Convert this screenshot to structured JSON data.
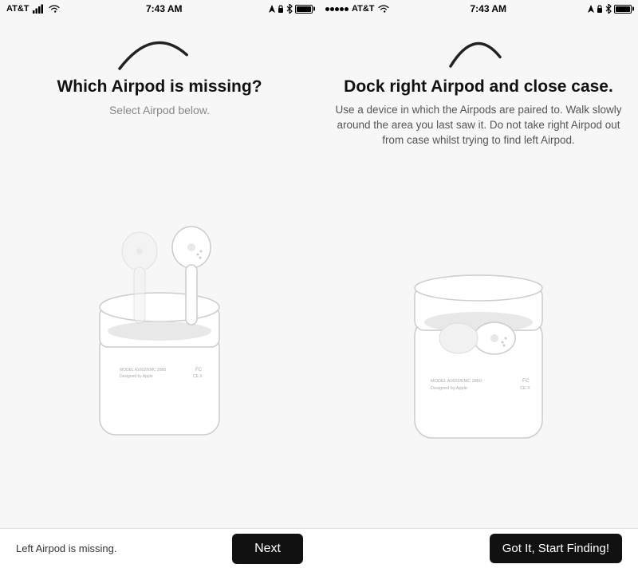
{
  "leftPanel": {
    "statusBar": {
      "carrier": "AT&T",
      "time": "7:43 AM",
      "battery": "100%"
    },
    "title": "Which Airpod is missing?",
    "subtitle": "Select Airpod below.",
    "bottomStatus": "Left Airpod is missing.",
    "nextLabel": "Next"
  },
  "rightPanel": {
    "statusBar": {
      "carrier": "AT&T",
      "time": "7:43 AM",
      "battery": "100%"
    },
    "title": "Dock right Airpod and close case.",
    "subtitle": "Use a device in which the Airpods are paired to. Walk slowly around the area you last saw it. Do not take right Airpod out from case whilst trying to find left Airpod.",
    "startLabel": "Got It, Start Finding!"
  }
}
